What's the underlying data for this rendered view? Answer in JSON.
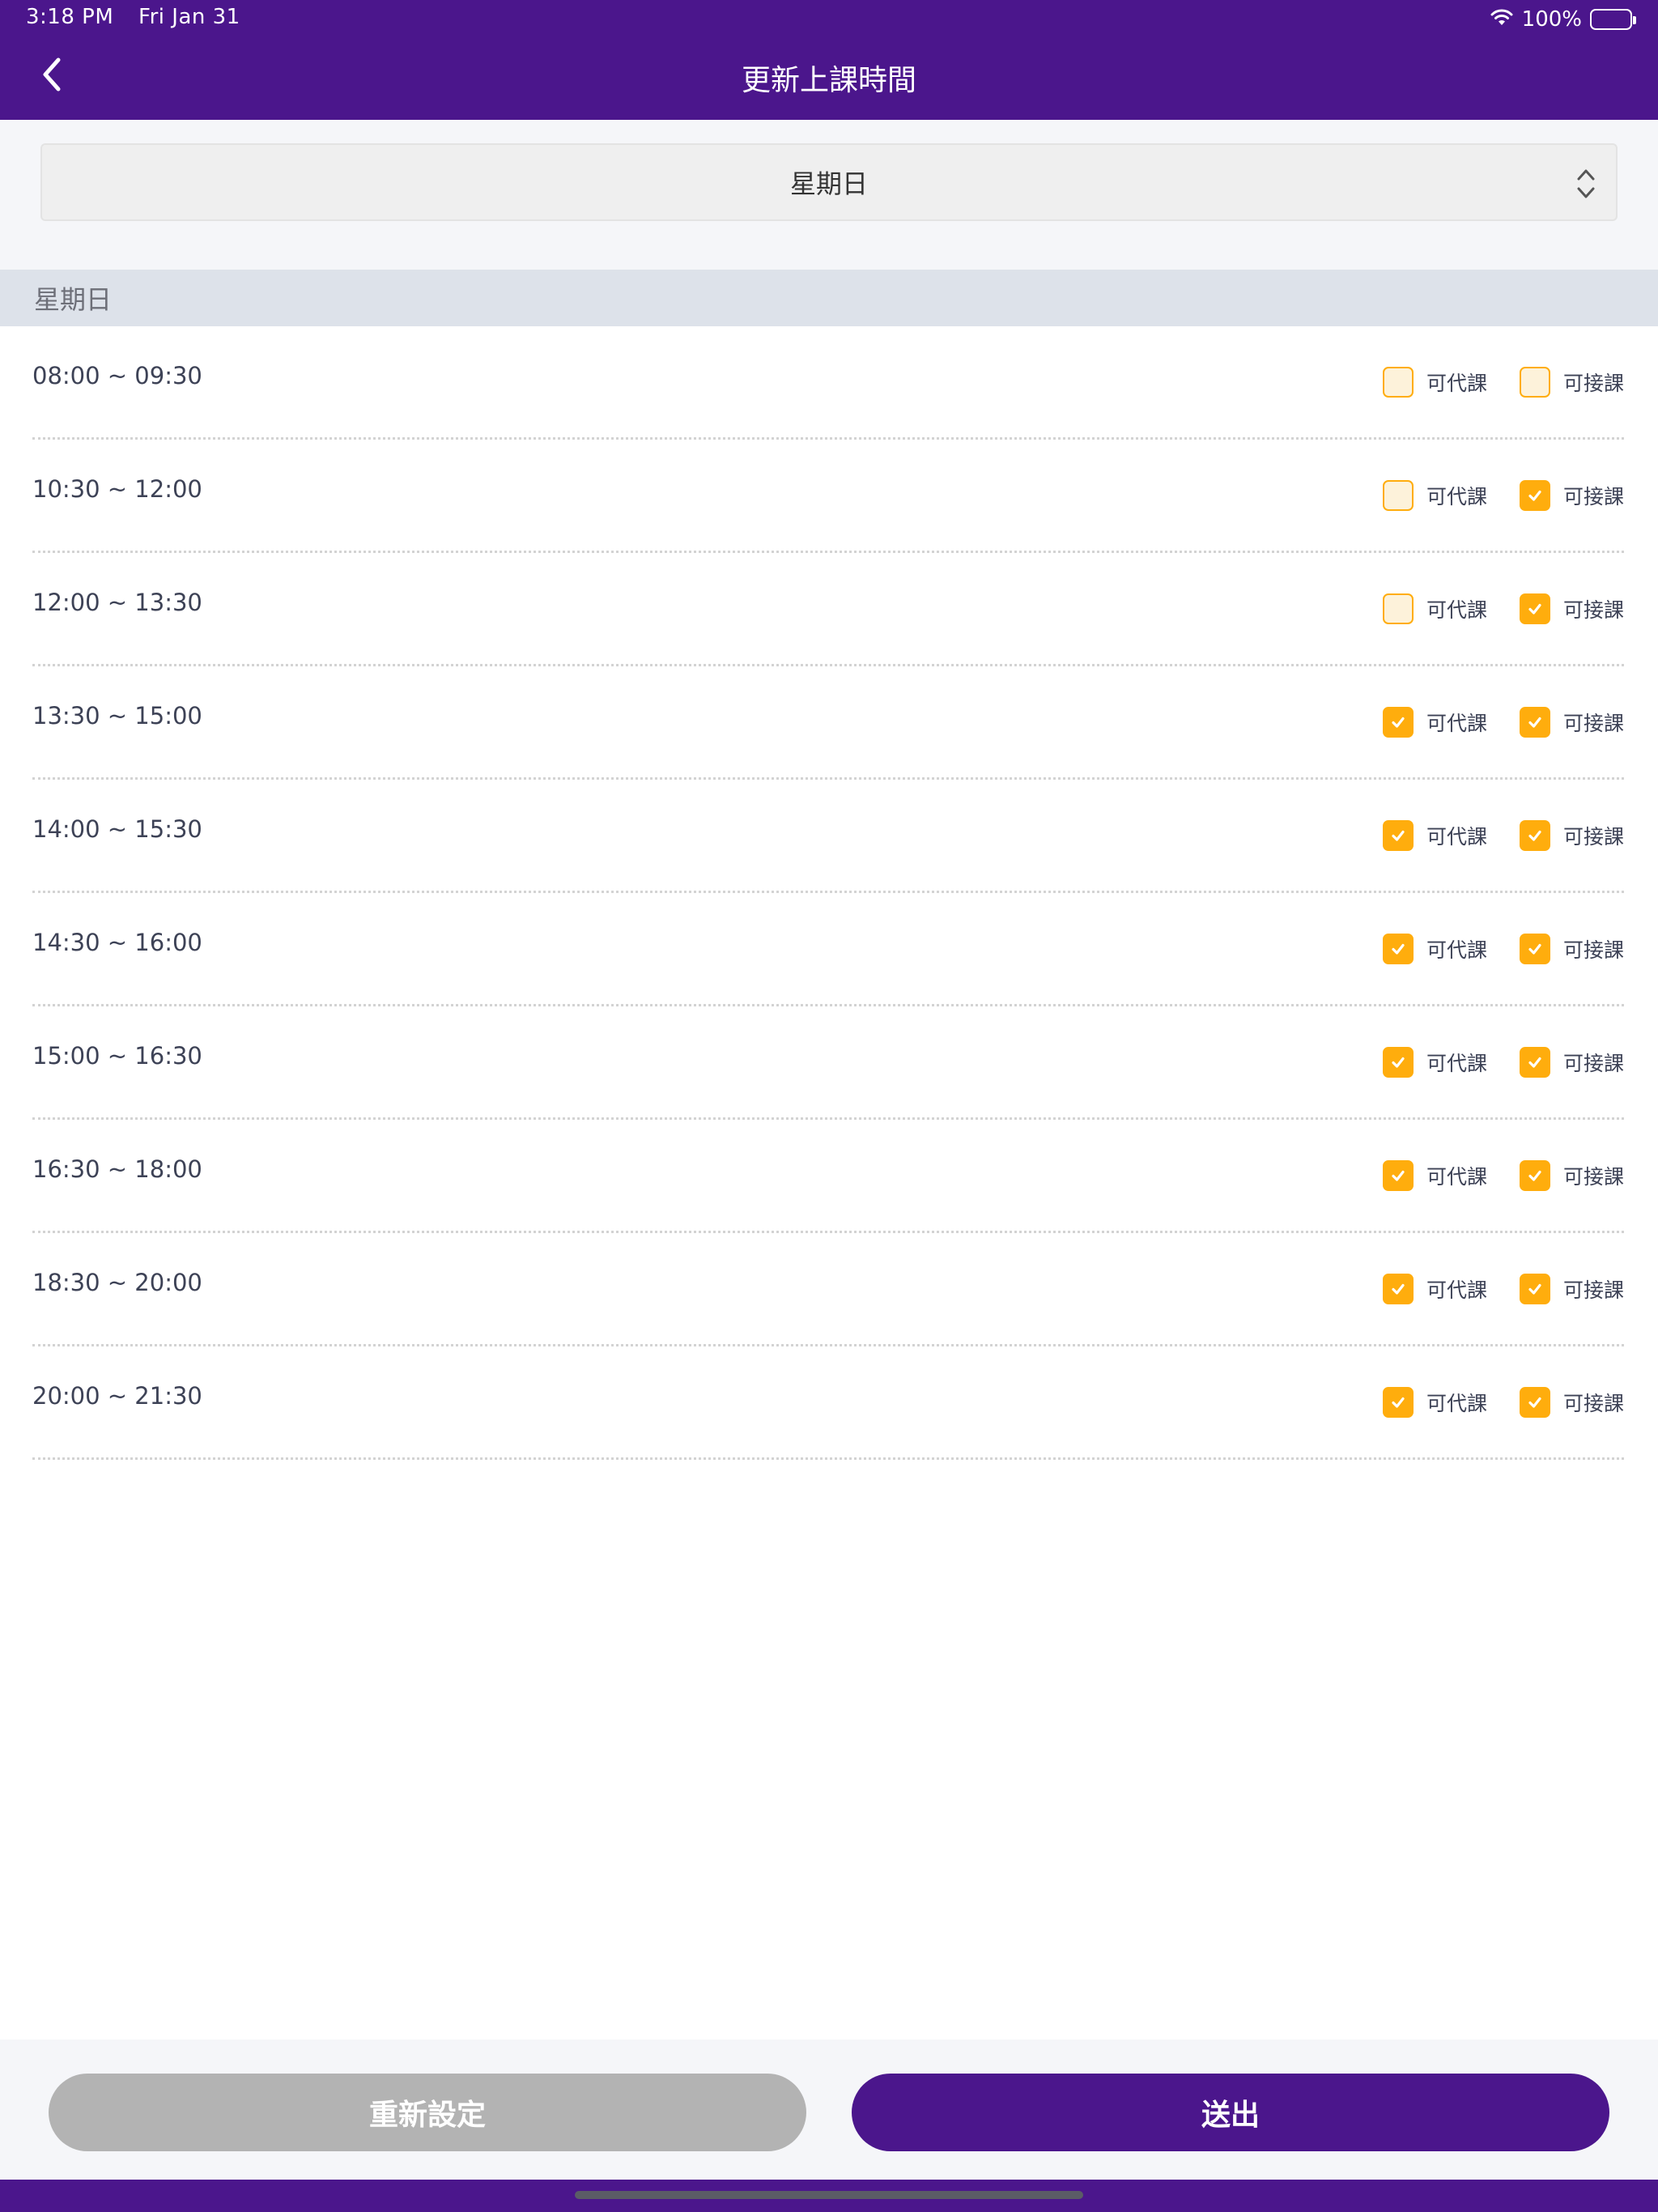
{
  "status_bar": {
    "time": "3:18 PM",
    "date": "Fri Jan 31",
    "battery": "100%"
  },
  "nav": {
    "title": "更新上課時間"
  },
  "selector": {
    "value": "星期日"
  },
  "section": {
    "title": "星期日"
  },
  "option_labels": {
    "substitute": "可代課",
    "accept": "可接課"
  },
  "slots": [
    {
      "time": "08:00 ~ 09:30",
      "substitute": false,
      "accept": false
    },
    {
      "time": "10:30 ~ 12:00",
      "substitute": false,
      "accept": true
    },
    {
      "time": "12:00 ~ 13:30",
      "substitute": false,
      "accept": true
    },
    {
      "time": "13:30 ~ 15:00",
      "substitute": true,
      "accept": true
    },
    {
      "time": "14:00 ~ 15:30",
      "substitute": true,
      "accept": true
    },
    {
      "time": "14:30 ~ 16:00",
      "substitute": true,
      "accept": true
    },
    {
      "time": "15:00 ~ 16:30",
      "substitute": true,
      "accept": true
    },
    {
      "time": "16:30 ~ 18:00",
      "substitute": true,
      "accept": true
    },
    {
      "time": "18:30 ~ 20:00",
      "substitute": true,
      "accept": true
    },
    {
      "time": "20:00 ~ 21:30",
      "substitute": true,
      "accept": true
    }
  ],
  "buttons": {
    "reset": "重新設定",
    "submit": "送出"
  },
  "colors": {
    "primary": "#4b168c",
    "accent": "#ffad0d",
    "disabled": "#b3b3b3"
  }
}
